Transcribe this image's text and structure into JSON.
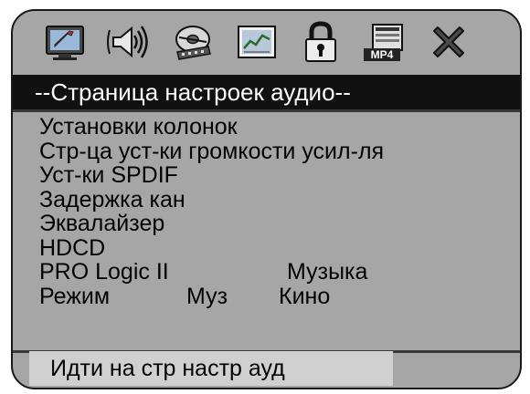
{
  "toolbar": {
    "icons": [
      {
        "name": "general-setup-icon",
        "selected": false
      },
      {
        "name": "audio-setup-icon",
        "selected": true
      },
      {
        "name": "video-setup-icon",
        "selected": false
      },
      {
        "name": "preference-setup-icon",
        "selected": false
      },
      {
        "name": "password-lock-icon",
        "selected": false
      },
      {
        "name": "mp4-setup-icon",
        "selected": false,
        "label": "MP4"
      },
      {
        "name": "exit-icon",
        "selected": false
      }
    ]
  },
  "header": {
    "title": "--Страница настроек аудио--"
  },
  "menu": {
    "items": [
      {
        "label": "Установки колонок"
      },
      {
        "label": "Стр-ца уст-ки громкости усил-ля"
      },
      {
        "label": "Уст-ки SPDIF"
      },
      {
        "label": "Задержка кан"
      },
      {
        "label": "Эквалайзер"
      },
      {
        "label": "HDCD"
      },
      {
        "label": "PRO Logic II",
        "value": "Музыка"
      },
      {
        "label": "Режим",
        "value": "Муз",
        "value2": "Кино"
      }
    ]
  },
  "status": {
    "text": "Идти на стр настр ауд"
  },
  "colors": {
    "panel": "#a6a6a6",
    "title_bar": "#111111",
    "status_bar": "#d0d0d0"
  }
}
